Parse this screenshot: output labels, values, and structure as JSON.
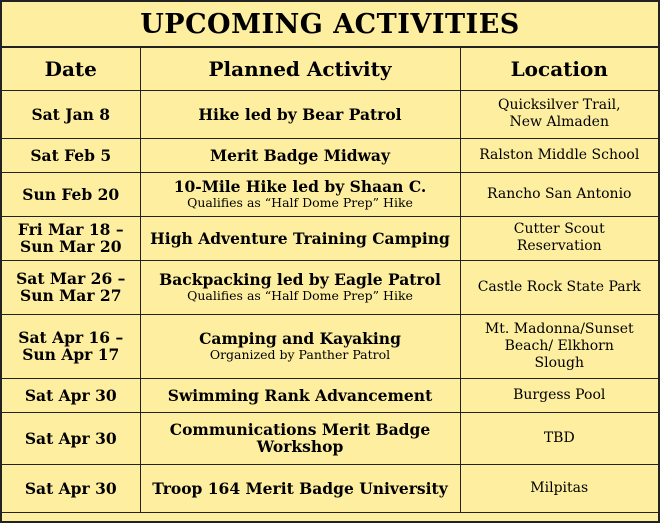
{
  "title": "UPCOMING ACTIVITIES",
  "headers": {
    "date": "Date",
    "activity": "Planned Activity",
    "location": "Location"
  },
  "rows": [
    {
      "date": [
        "Sat Jan 8"
      ],
      "activity": "Hike led by Bear Patrol",
      "note": "",
      "location": [
        "Quicksilver Trail,",
        "New Almaden"
      ]
    },
    {
      "date": [
        "Sat Feb 5"
      ],
      "activity": "Merit Badge Midway",
      "note": "",
      "location": [
        "Ralston Middle School"
      ]
    },
    {
      "date": [
        "Sun Feb 20"
      ],
      "activity": "10-Mile Hike led by Shaan C.",
      "note": "Qualifies as “Half Dome Prep” Hike",
      "location": [
        "Rancho San Antonio"
      ]
    },
    {
      "date": [
        "Fri Mar 18 –",
        "Sun Mar 20"
      ],
      "activity": "High Adventure Training Camping",
      "note": "",
      "location": [
        "Cutter Scout",
        "Reservation"
      ]
    },
    {
      "date": [
        "Sat Mar 26 –",
        "Sun Mar 27"
      ],
      "activity": "Backpacking led by Eagle Patrol",
      "note": "Qualifies as “Half Dome Prep” Hike",
      "location": [
        "Castle Rock State Park"
      ]
    },
    {
      "date": [
        "Sat Apr 16 –",
        "Sun Apr 17"
      ],
      "activity": "Camping and Kayaking",
      "note": "Organized by Panther Patrol",
      "location": [
        "Mt. Madonna/Sunset",
        "Beach/ Elkhorn",
        "Slough"
      ]
    },
    {
      "date": [
        "Sat Apr 30"
      ],
      "activity": "Swimming Rank Advancement",
      "note": "",
      "location": [
        "Burgess Pool"
      ]
    },
    {
      "date": [
        "Sat Apr 30"
      ],
      "activity": "Communications Merit Badge Workshop",
      "note": "",
      "location": [
        "TBD"
      ]
    },
    {
      "date": [
        "Sat Apr 30"
      ],
      "activity": "Troop 164 Merit Badge University",
      "note": "",
      "location": [
        "Milpitas"
      ]
    }
  ],
  "colors": {
    "background": "#fdeea0",
    "border": "#222222",
    "text": "#000000"
  }
}
